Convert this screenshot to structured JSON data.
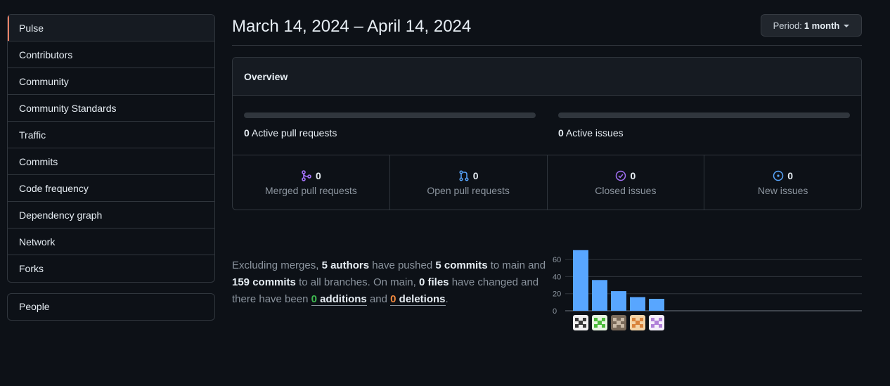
{
  "sidebar": {
    "items": [
      {
        "label": "Pulse",
        "selected": true
      },
      {
        "label": "Contributors"
      },
      {
        "label": "Community"
      },
      {
        "label": "Community Standards"
      },
      {
        "label": "Traffic"
      },
      {
        "label": "Commits"
      },
      {
        "label": "Code frequency"
      },
      {
        "label": "Dependency graph"
      },
      {
        "label": "Network"
      },
      {
        "label": "Forks"
      }
    ],
    "people_label": "People"
  },
  "header": {
    "date_range": "March 14, 2024 – April 14, 2024",
    "period_prefix": "Period:",
    "period_value": "1 month"
  },
  "overview": {
    "title": "Overview",
    "active_prs_count": "0",
    "active_prs_label": "Active pull requests",
    "active_prs_fill": 0,
    "active_issues_count": "0",
    "active_issues_label": "Active issues",
    "active_issues_fill": 0,
    "stats": [
      {
        "icon": "git-merge-icon",
        "count": "0",
        "label": "Merged pull requests",
        "color": "#a371f7"
      },
      {
        "icon": "git-pull-request-icon",
        "count": "0",
        "label": "Open pull requests",
        "color": "#58a6ff"
      },
      {
        "icon": "issue-closed-icon",
        "count": "0",
        "label": "Closed issues",
        "color": "#a371f7"
      },
      {
        "icon": "issue-opened-icon",
        "count": "0",
        "label": "New issues",
        "color": "#58a6ff"
      }
    ]
  },
  "summary": {
    "t1": "Excluding merges,",
    "authors": "5 authors",
    "t2": "have pushed",
    "commits": "5 commits",
    "t3": "to main and",
    "branch_commits": "159 commits",
    "t4": "to all branches. On main,",
    "files": "0 files",
    "t5": "have changed and there have been",
    "additions_num": "0",
    "additions_word": "additions",
    "t6": "and",
    "deletions_num": "0",
    "deletions_word": "deletions",
    "t7": "."
  },
  "chart_data": {
    "type": "bar",
    "categories": [
      "author-1",
      "author-2",
      "author-3",
      "author-4",
      "author-5"
    ],
    "values": [
      71,
      36,
      23,
      16,
      14
    ],
    "ylim": [
      0,
      70
    ],
    "yticks": [
      0,
      20,
      40,
      60
    ],
    "bar_color": "#58a6ff",
    "grid": true
  },
  "avatars": [
    {
      "name": "avatar-1",
      "bg": "#f0f0f0",
      "fg": "#3a3a3a"
    },
    {
      "name": "avatar-2",
      "bg": "#e8f5e1",
      "fg": "#4cbb3a"
    },
    {
      "name": "avatar-3",
      "bg": "#7a6a5a",
      "fg": "#c9b9a6"
    },
    {
      "name": "avatar-4",
      "bg": "#f3d3a6",
      "fg": "#d9823a"
    },
    {
      "name": "avatar-5",
      "bg": "#f4eefa",
      "fg": "#b07fd8"
    }
  ]
}
